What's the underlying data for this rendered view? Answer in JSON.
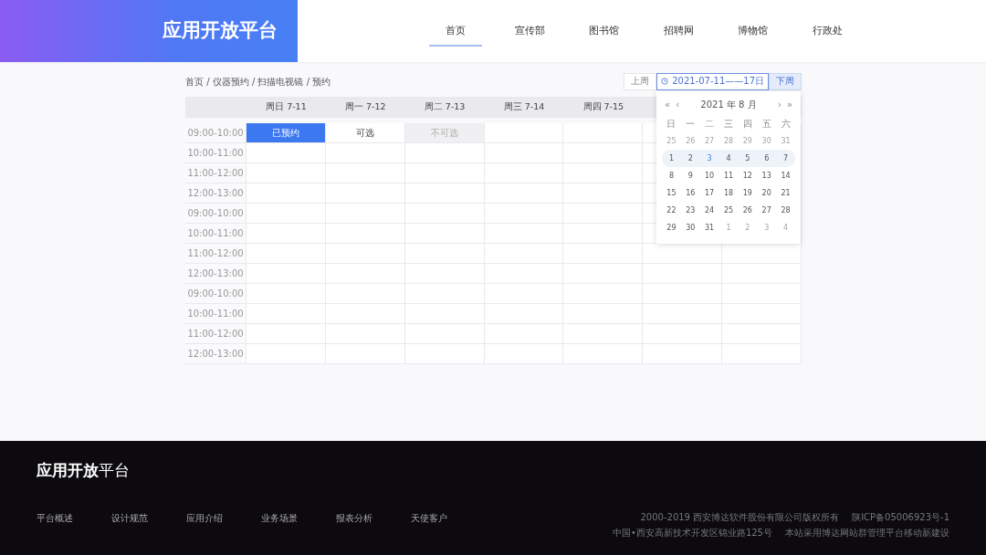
{
  "header": {
    "logo": "应用开放平台",
    "nav": [
      {
        "label": "首页",
        "selected": true
      },
      {
        "label": "宣传部",
        "selected": false
      },
      {
        "label": "图书馆",
        "selected": false
      },
      {
        "label": "招聘网",
        "selected": false
      },
      {
        "label": "博物馆",
        "selected": false
      },
      {
        "label": "行政处",
        "selected": false
      }
    ]
  },
  "breadcrumb": "首页 / 仪器预约 / 扫描电视镜 / 预约",
  "week_picker": {
    "prev": "上周",
    "range": "2021-07-11——17日",
    "next": "下周"
  },
  "schedule": {
    "columns": [
      "周日 7-11",
      "周一 7-12",
      "周二 7-13",
      "周三 7-14",
      "周四 7-15"
    ],
    "rows": [
      {
        "time": "09:00-10:00",
        "cells": [
          {
            "kind": "booked",
            "text": "已预约"
          },
          {
            "kind": "available",
            "text": "可选"
          },
          {
            "kind": "unavailable",
            "text": "不可选"
          },
          {
            "kind": "empty"
          },
          {
            "kind": "empty"
          },
          {
            "kind": "empty"
          },
          {
            "kind": "empty"
          }
        ]
      },
      {
        "time": "10:00-11:00",
        "cells": [
          {
            "kind": "empty"
          },
          {
            "kind": "empty"
          },
          {
            "kind": "empty"
          },
          {
            "kind": "empty"
          },
          {
            "kind": "empty"
          },
          {
            "kind": "empty"
          },
          {
            "kind": "empty"
          }
        ]
      },
      {
        "time": "11:00-12:00",
        "cells": [
          {
            "kind": "empty"
          },
          {
            "kind": "empty"
          },
          {
            "kind": "empty"
          },
          {
            "kind": "empty"
          },
          {
            "kind": "empty"
          },
          {
            "kind": "empty"
          },
          {
            "kind": "empty"
          }
        ]
      },
      {
        "time": "12:00-13:00",
        "cells": [
          {
            "kind": "empty"
          },
          {
            "kind": "empty"
          },
          {
            "kind": "empty"
          },
          {
            "kind": "empty"
          },
          {
            "kind": "empty"
          },
          {
            "kind": "empty"
          },
          {
            "kind": "empty"
          }
        ]
      },
      {
        "time": "09:00-10:00",
        "cells": [
          {
            "kind": "empty"
          },
          {
            "kind": "empty"
          },
          {
            "kind": "empty"
          },
          {
            "kind": "empty"
          },
          {
            "kind": "empty"
          },
          {
            "kind": "empty"
          },
          {
            "kind": "empty"
          }
        ]
      },
      {
        "time": "10:00-11:00",
        "cells": [
          {
            "kind": "empty"
          },
          {
            "kind": "empty"
          },
          {
            "kind": "empty"
          },
          {
            "kind": "empty"
          },
          {
            "kind": "empty"
          },
          {
            "kind": "empty"
          },
          {
            "kind": "empty"
          }
        ]
      },
      {
        "time": "11:00-12:00",
        "cells": [
          {
            "kind": "empty"
          },
          {
            "kind": "empty"
          },
          {
            "kind": "empty"
          },
          {
            "kind": "empty"
          },
          {
            "kind": "empty"
          },
          {
            "kind": "empty"
          },
          {
            "kind": "empty"
          }
        ]
      },
      {
        "time": "12:00-13:00",
        "cells": [
          {
            "kind": "empty"
          },
          {
            "kind": "empty"
          },
          {
            "kind": "empty"
          },
          {
            "kind": "empty"
          },
          {
            "kind": "empty"
          },
          {
            "kind": "empty"
          },
          {
            "kind": "empty"
          }
        ]
      },
      {
        "time": "09:00-10:00",
        "cells": [
          {
            "kind": "empty"
          },
          {
            "kind": "empty"
          },
          {
            "kind": "empty"
          },
          {
            "kind": "empty"
          },
          {
            "kind": "empty"
          },
          {
            "kind": "empty"
          },
          {
            "kind": "empty"
          }
        ]
      },
      {
        "time": "10:00-11:00",
        "cells": [
          {
            "kind": "empty"
          },
          {
            "kind": "empty"
          },
          {
            "kind": "empty"
          },
          {
            "kind": "empty"
          },
          {
            "kind": "empty"
          },
          {
            "kind": "empty"
          },
          {
            "kind": "empty"
          }
        ]
      },
      {
        "time": "11:00-12:00",
        "cells": [
          {
            "kind": "empty"
          },
          {
            "kind": "empty"
          },
          {
            "kind": "empty"
          },
          {
            "kind": "empty"
          },
          {
            "kind": "empty"
          },
          {
            "kind": "empty"
          },
          {
            "kind": "empty"
          }
        ]
      },
      {
        "time": "12:00-13:00",
        "cells": [
          {
            "kind": "empty"
          },
          {
            "kind": "empty"
          },
          {
            "kind": "empty"
          },
          {
            "kind": "empty"
          },
          {
            "kind": "empty"
          },
          {
            "kind": "empty"
          },
          {
            "kind": "empty"
          }
        ]
      }
    ]
  },
  "calendar": {
    "prev_year": "«",
    "prev_month": "‹",
    "title": "2021 年  8 月",
    "next_month": "›",
    "next_year": "»",
    "weekdays": [
      "日",
      "一",
      "二",
      "三",
      "四",
      "五",
      "六"
    ],
    "weeks": [
      {
        "selected": false,
        "days": [
          {
            "text": "25",
            "kind": "other"
          },
          {
            "text": "26",
            "kind": "other"
          },
          {
            "text": "27",
            "kind": "other"
          },
          {
            "text": "28",
            "kind": "other"
          },
          {
            "text": "29",
            "kind": "other"
          },
          {
            "text": "30",
            "kind": "other"
          },
          {
            "text": "31",
            "kind": "other"
          }
        ]
      },
      {
        "selected": true,
        "days": [
          {
            "text": "1",
            "kind": "current"
          },
          {
            "text": "2",
            "kind": "current"
          },
          {
            "text": "3",
            "kind": "today"
          },
          {
            "text": "4",
            "kind": "current"
          },
          {
            "text": "5",
            "kind": "current"
          },
          {
            "text": "6",
            "kind": "current"
          },
          {
            "text": "7",
            "kind": "current"
          }
        ]
      },
      {
        "selected": false,
        "days": [
          {
            "text": "8",
            "kind": "current"
          },
          {
            "text": "9",
            "kind": "current"
          },
          {
            "text": "10",
            "kind": "current"
          },
          {
            "text": "11",
            "kind": "current"
          },
          {
            "text": "12",
            "kind": "current"
          },
          {
            "text": "13",
            "kind": "current"
          },
          {
            "text": "14",
            "kind": "current"
          }
        ]
      },
      {
        "selected": false,
        "days": [
          {
            "text": "15",
            "kind": "current"
          },
          {
            "text": "16",
            "kind": "current"
          },
          {
            "text": "17",
            "kind": "current"
          },
          {
            "text": "18",
            "kind": "current"
          },
          {
            "text": "19",
            "kind": "current"
          },
          {
            "text": "20",
            "kind": "current"
          },
          {
            "text": "21",
            "kind": "current"
          }
        ]
      },
      {
        "selected": false,
        "days": [
          {
            "text": "22",
            "kind": "current"
          },
          {
            "text": "23",
            "kind": "current"
          },
          {
            "text": "24",
            "kind": "current"
          },
          {
            "text": "25",
            "kind": "current"
          },
          {
            "text": "26",
            "kind": "current"
          },
          {
            "text": "27",
            "kind": "current"
          },
          {
            "text": "28",
            "kind": "current"
          }
        ]
      },
      {
        "selected": false,
        "days": [
          {
            "text": "29",
            "kind": "current"
          },
          {
            "text": "30",
            "kind": "current"
          },
          {
            "text": "31",
            "kind": "current"
          },
          {
            "text": "1",
            "kind": "other"
          },
          {
            "text": "2",
            "kind": "other"
          },
          {
            "text": "3",
            "kind": "other"
          },
          {
            "text": "4",
            "kind": "other"
          }
        ]
      }
    ]
  },
  "footer": {
    "logo_bold": "应用开放",
    "logo_light": "平台",
    "links": [
      "平台概述",
      "设计规范",
      "应用介绍",
      "业务场景",
      "报表分析",
      "天使客户"
    ],
    "copyright": "2000-2019 西安博达软件股份有限公司版权所有",
    "icp": "陕ICP备05006923号-1",
    "address": "中国•西安高新技术开发区锦业路125号",
    "note": "本站采用博达网站群管理平台移动新建设"
  }
}
